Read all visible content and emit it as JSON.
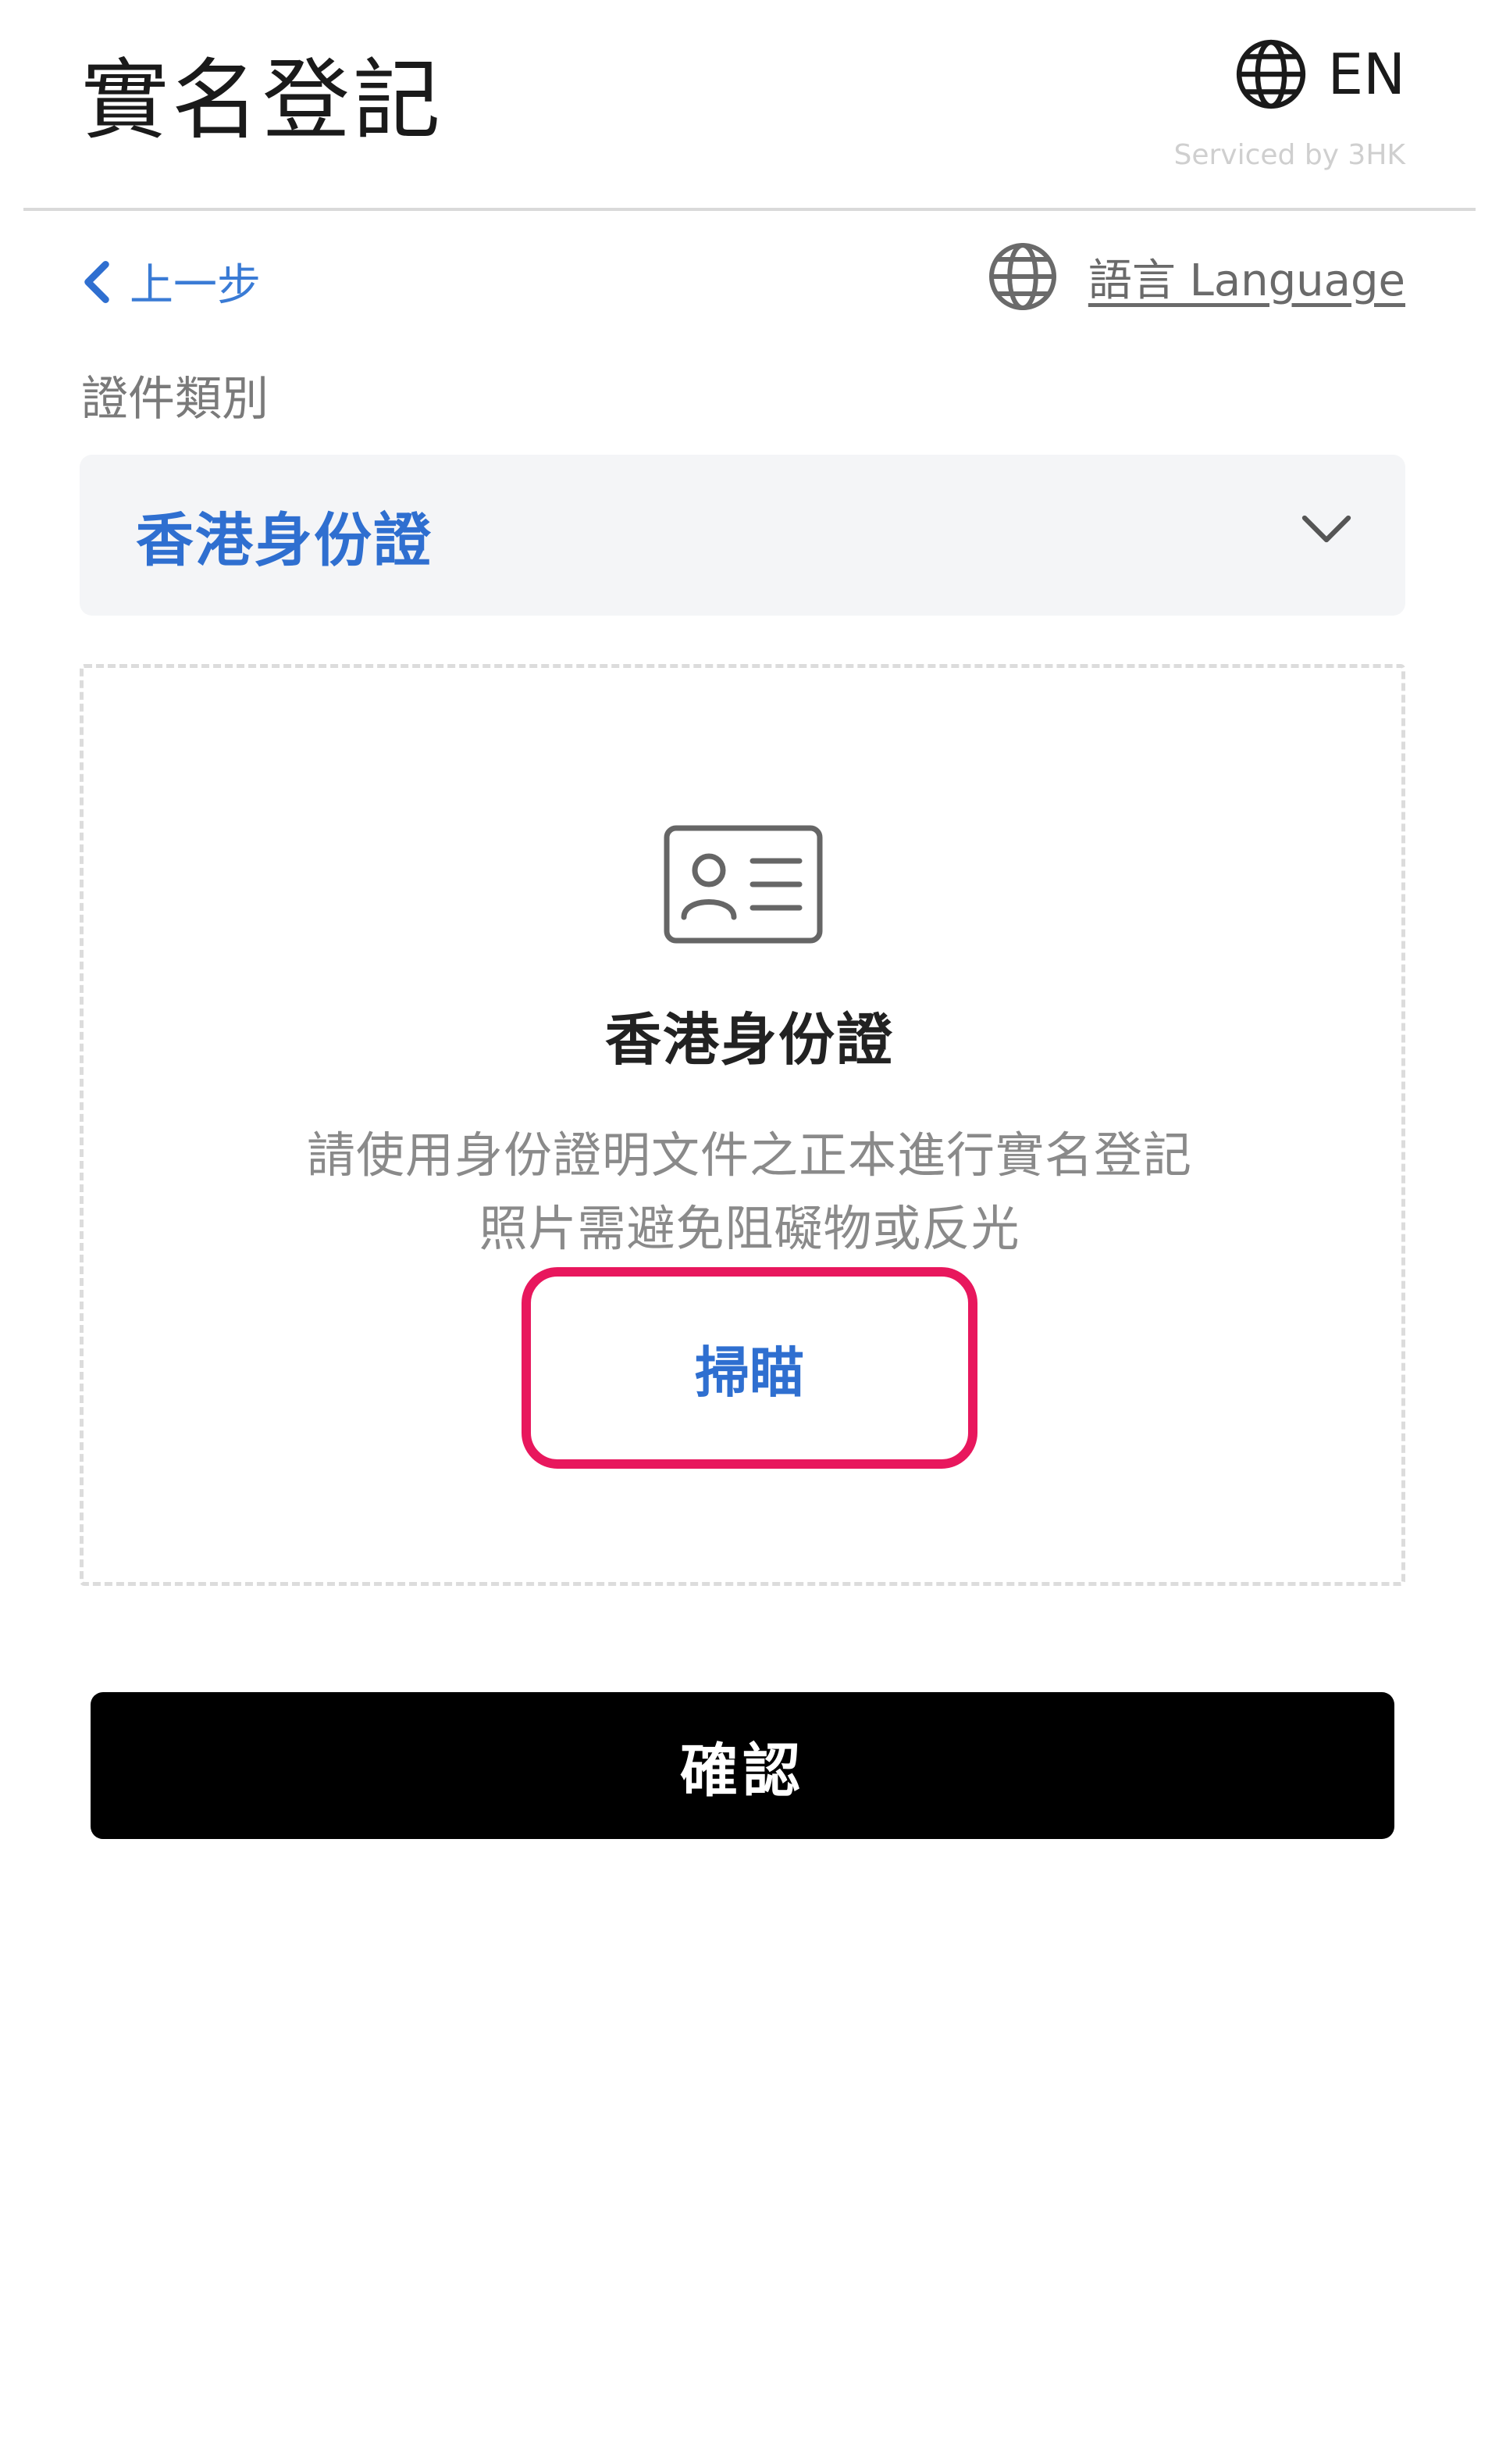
{
  "header": {
    "title": "實名登記",
    "lang_code": "EN",
    "serviced_by": "Serviced by 3HK"
  },
  "nav": {
    "back_label": "上一步",
    "language_label": "語言 Language"
  },
  "form": {
    "document_type_label": "證件類別",
    "document_type_value": "香港身份證"
  },
  "upload": {
    "title": "香港身份證",
    "description_line1": "請使用身份證明文件之正本進行實名登記",
    "description_line2": "照片需避免阻礙物或反光",
    "scan_label": "掃瞄",
    "icon": "id-card-icon"
  },
  "confirm_label": "確認",
  "colors": {
    "accent_blue": "#2f6fd0",
    "highlight": "#e8175d",
    "confirm_bg": "#000000",
    "select_bg": "#f4f5f7"
  }
}
